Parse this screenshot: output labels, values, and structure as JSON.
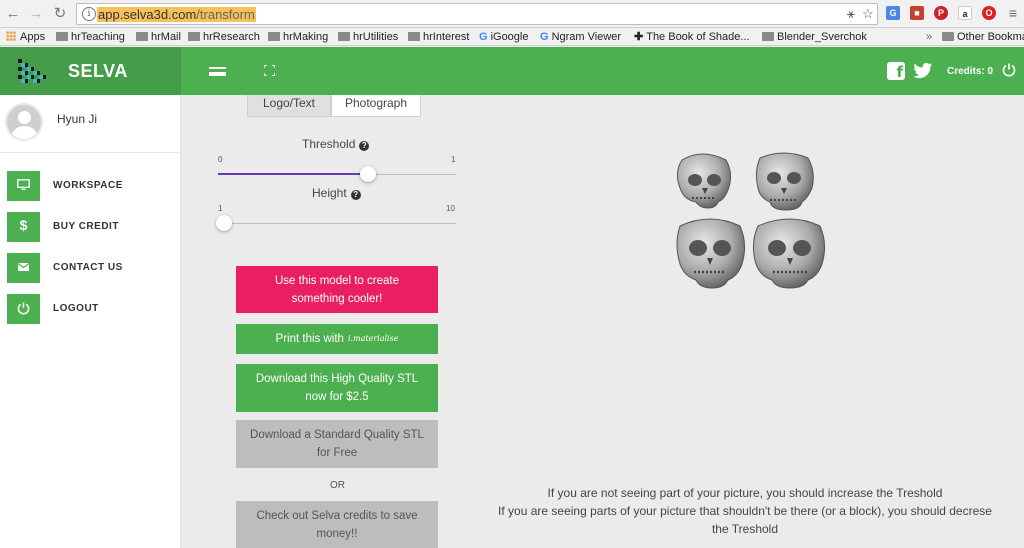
{
  "browser": {
    "url_host": "app.selva3d.com",
    "url_path": "/transform",
    "bookmarks": [
      "Apps",
      "hrTeaching",
      "hrMail",
      "hrResearch",
      "hrMaking",
      "hrUtilities",
      "hrInterest",
      "iGoogle",
      "Ngram Viewer",
      "The Book of Shade...",
      "Blender_Sverchok"
    ],
    "overflow": "»",
    "other_bookmarks": "Other Bookmarks"
  },
  "header": {
    "app_name": "SELVA",
    "credits_label": "Credits: 0",
    "accent": "#4caf50",
    "brand_bg": "#449d48"
  },
  "sidebar": {
    "username": "Hyun Ji",
    "items": [
      {
        "label": "WORKSPACE",
        "icon": "monitor-icon"
      },
      {
        "label": "BUY CREDIT",
        "icon": "dollar-icon",
        "glyph": "$"
      },
      {
        "label": "CONTACT US",
        "icon": "mail-icon"
      },
      {
        "label": "LOGOUT",
        "icon": "power-icon"
      }
    ]
  },
  "tabs": {
    "logo": "Logo/Text",
    "photo": "Photograph",
    "active": "Photograph"
  },
  "threshold": {
    "label": "Threshold",
    "min": "0",
    "max": "1",
    "value_fraction": 0.63
  },
  "height": {
    "label": "Height",
    "min": "1",
    "max": "10",
    "value_fraction": 0.0
  },
  "actions": {
    "remix_line1": "Use this model to create",
    "remix_line2": "something cooler!",
    "print_label": "Print this with",
    "print_partner": "i.materialise",
    "hq_line1": "Download this High Quality STL",
    "hq_line2": "now for $2.5",
    "std_line1": "Download a Standard Quality STL",
    "std_line2": "for Free",
    "or": "OR",
    "credits_line1": "Check out Selva credits to save",
    "credits_line2": "money!!"
  },
  "hints": {
    "line1": "If you are not seeing part of your picture, you should increase the Treshold",
    "line2": "If you are seeing parts of your picture that shouldn't be there (or a block), you should decrese",
    "line3": "the Treshold"
  }
}
